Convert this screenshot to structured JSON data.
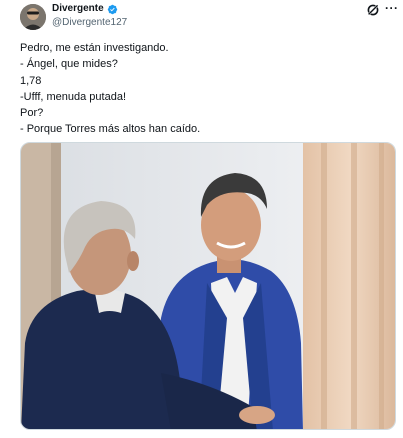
{
  "tweet": {
    "author_name": "Divergente",
    "author_handle": "@Divergente127",
    "lines": [
      "Pedro, me están investigando.",
      "- Ángel, que mides?",
      "1,78",
      "-Ufff, menuda putada!",
      "Por?",
      "- Porque Torres más altos han caído."
    ]
  },
  "icons": {
    "verified": "verified-badge-icon",
    "grok": "grok-icon",
    "more": "more-options-icon"
  },
  "colors": {
    "verified_blue": "#1d9bf0",
    "text_primary": "#0f1419",
    "text_secondary": "#536471",
    "border": "#cfd9de"
  }
}
